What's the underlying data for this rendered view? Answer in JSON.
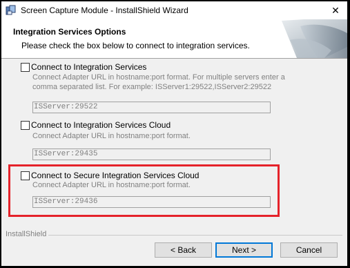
{
  "window": {
    "title": "Screen Capture Module - InstallShield Wizard",
    "close_glyph": "✕"
  },
  "banner": {
    "title": "Integration Services Options",
    "subtitle": "Please check the box below to connect to integration services."
  },
  "options": [
    {
      "label": "Connect to Integration Services",
      "checked": false,
      "description": [
        "Connect Adapter URL in hostname:port format. For multiple servers enter a",
        "comma separated list.  For example: ISServer1:29522,ISServer2:29522"
      ],
      "value": "ISServer:29522"
    },
    {
      "label": "Connect to Integration Services Cloud",
      "checked": false,
      "description": [
        "Connect Adapter URL in hostname:port format."
      ],
      "value": "ISServer:29435"
    },
    {
      "label": "Connect to Secure Integration Services Cloud",
      "checked": false,
      "description": [
        "Connect Adapter URL in hostname:port format."
      ],
      "value": "ISServer:29436"
    }
  ],
  "footer": {
    "brand": "InstallShield"
  },
  "buttons": {
    "back": "< Back",
    "next": "Next >",
    "cancel": "Cancel"
  },
  "colors": {
    "highlight": "#e5222a",
    "focus_border": "#0078d7"
  }
}
